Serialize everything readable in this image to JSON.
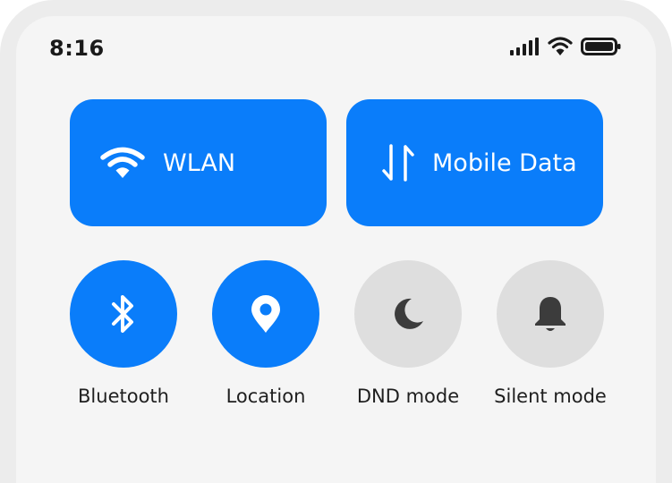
{
  "status_bar": {
    "time": "8:16",
    "icons": [
      "signal-icon",
      "wifi-icon",
      "battery-icon"
    ]
  },
  "tiles": [
    {
      "label": "WLAN",
      "icon": "wifi-icon",
      "state": "on"
    },
    {
      "label": "Mobile Data",
      "icon": "mobile-data-arrows-icon",
      "state": "on"
    }
  ],
  "toggles": [
    {
      "label": "Bluetooth",
      "icon": "bluetooth-icon",
      "state": "on"
    },
    {
      "label": "Location",
      "icon": "location-pin-icon",
      "state": "on"
    },
    {
      "label": "DND mode",
      "icon": "moon-icon",
      "state": "off"
    },
    {
      "label": "Silent mode",
      "icon": "bell-icon",
      "state": "off"
    }
  ],
  "colors": {
    "accent": "#0a7dfa",
    "off_background": "#dedede",
    "off_icon": "#3c3c3c",
    "panel_background": "#f5f5f5",
    "frame": "#ececec"
  }
}
